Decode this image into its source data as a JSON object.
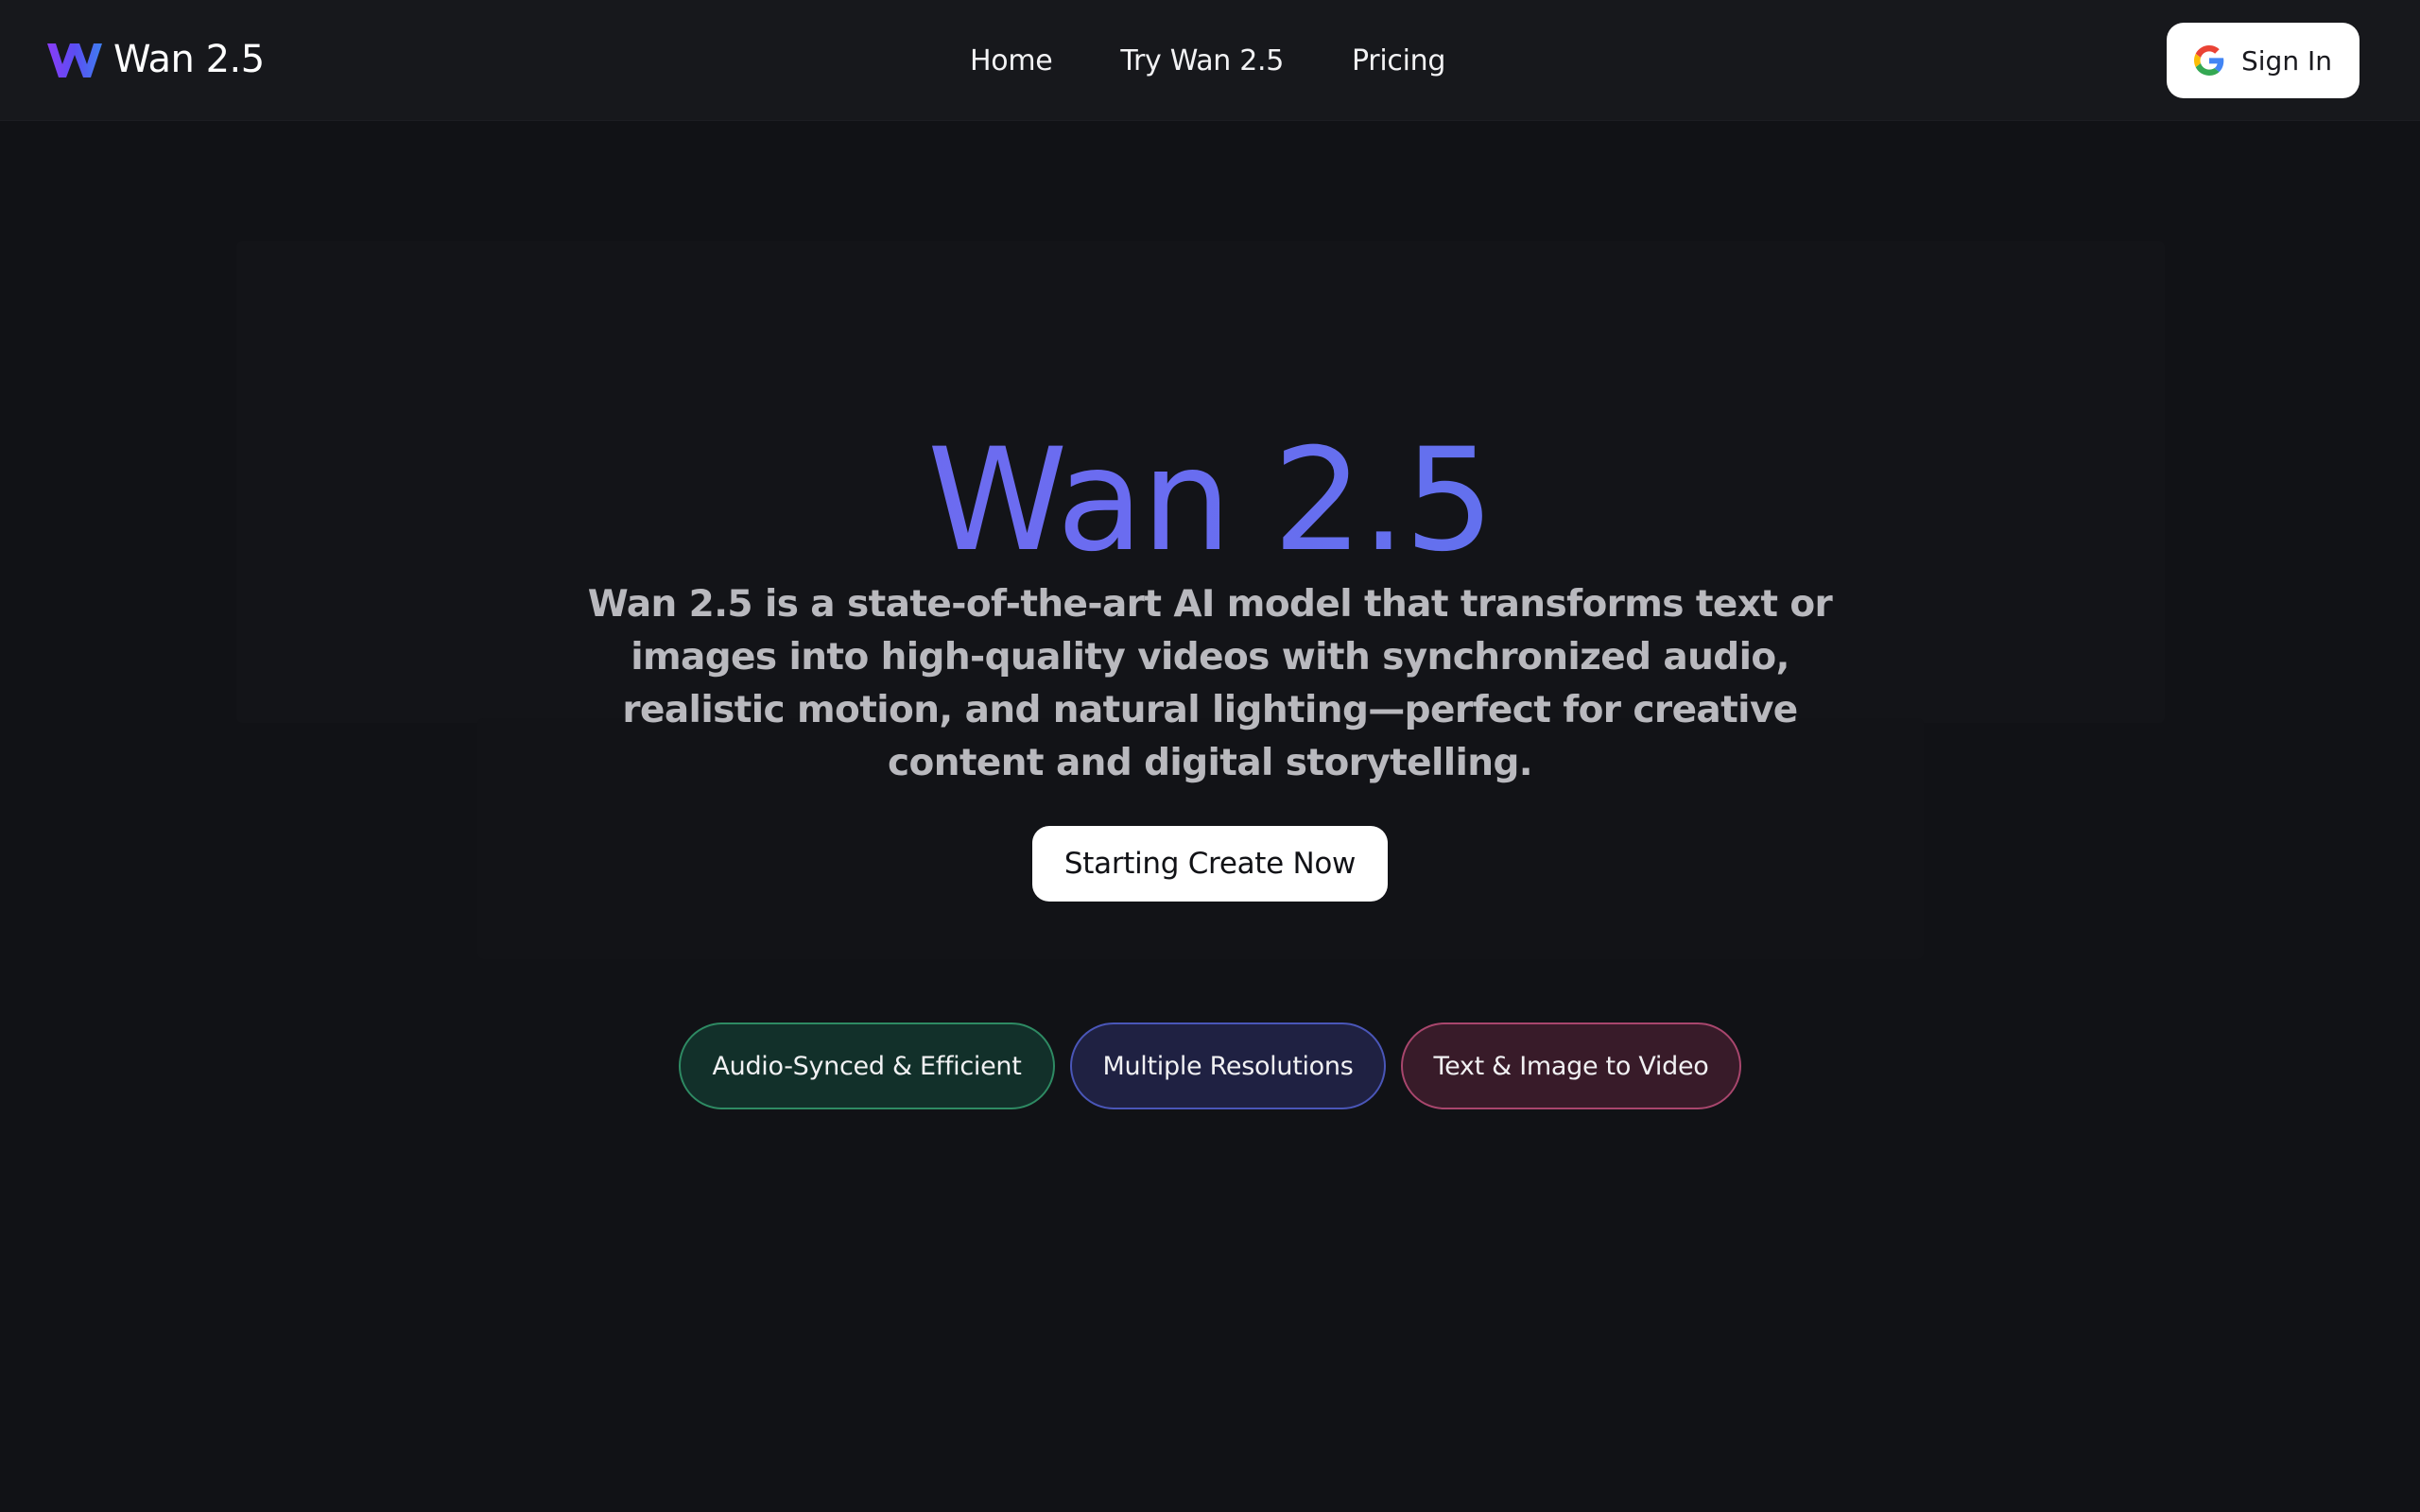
{
  "header": {
    "brand_name": "Wan 2.5",
    "logo_icon": "w-logo-icon",
    "nav": [
      {
        "label": "Home"
      },
      {
        "label": "Try Wan 2.5"
      },
      {
        "label": "Pricing"
      }
    ],
    "signin": {
      "label": "Sign In",
      "icon": "google-icon"
    }
  },
  "hero": {
    "title": "Wan 2.5",
    "description": "Wan 2.5 is a state-of-the-art AI model that transforms text or images into high-quality videos with synchronized audio, realistic motion, and natural lighting—perfect for creative content and digital storytelling.",
    "cta_label": "Starting Create Now"
  },
  "features": [
    {
      "label": "Audio-Synced & Efficient",
      "color": "#2e8a63"
    },
    {
      "label": "Multiple Resolutions",
      "color": "#4a56b8"
    },
    {
      "label": "Text & Image to Video",
      "color": "#a8466d"
    }
  ],
  "colors": {
    "background": "#111216",
    "header": "#17181c",
    "title_gradient_start": "#7367f0",
    "title_gradient_end": "#4f7bea",
    "description": "#b9b9be"
  }
}
